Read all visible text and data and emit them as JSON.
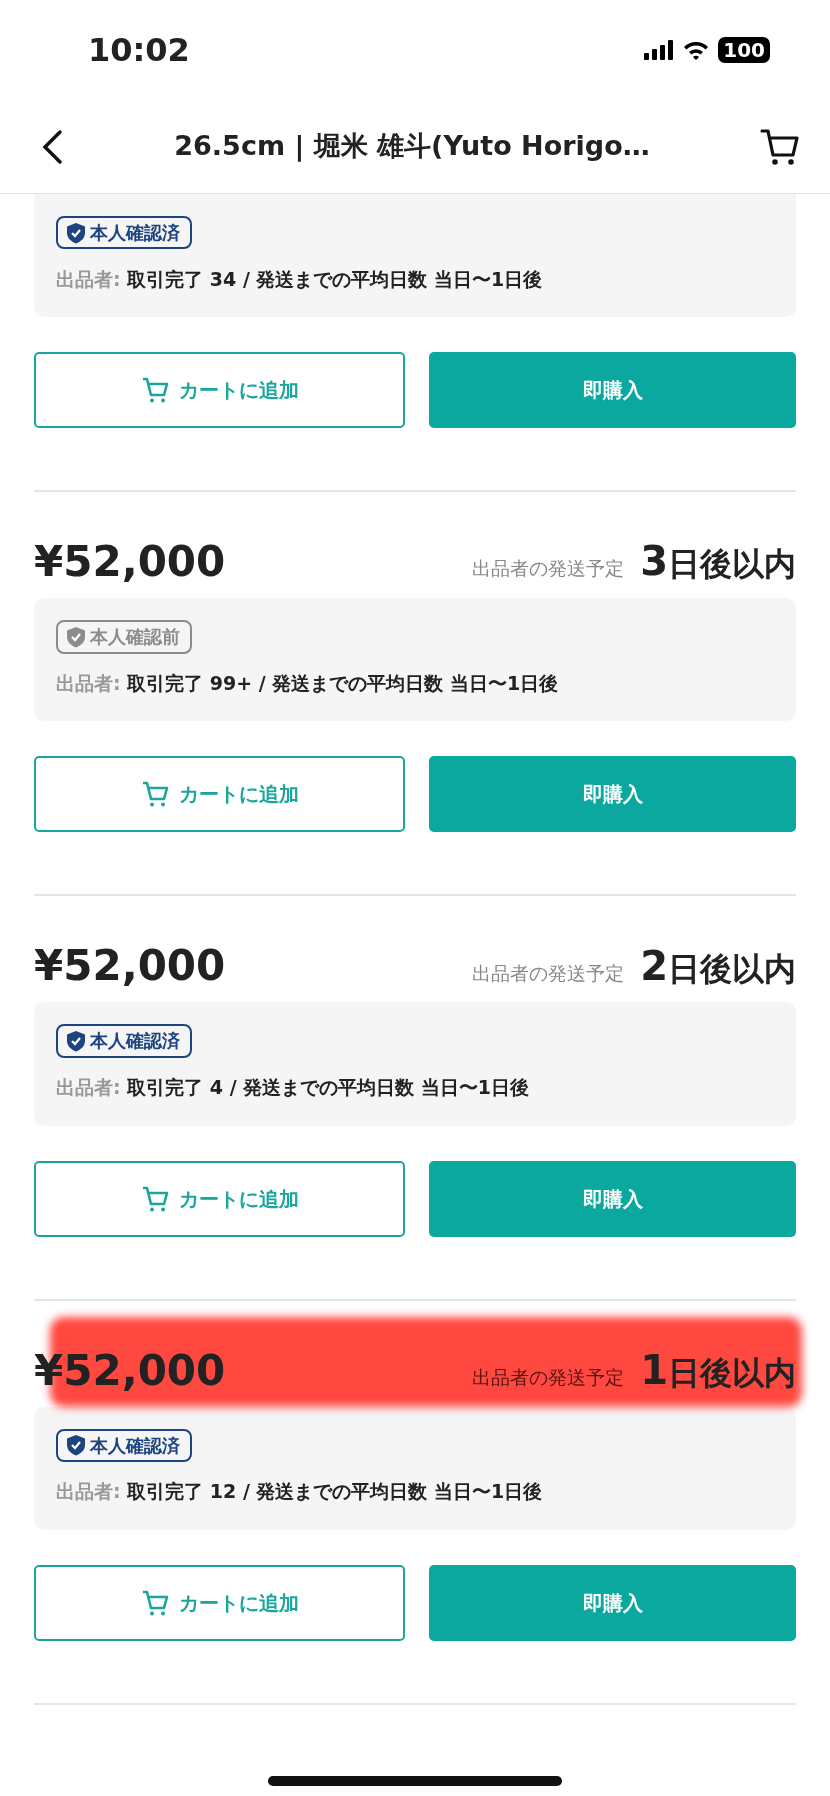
{
  "status_bar": {
    "time": "10:02",
    "battery": "100"
  },
  "header": {
    "title": "26.5cm | 堀米 雄斗(Yuto Horigo…"
  },
  "listings": [
    {
      "verified": true,
      "badge": "本人確認済",
      "seller_label": "出品者:",
      "seller_info": "取引完了 34 / 発送までの平均日数 当日〜1日後",
      "cart_button": "カートに追加",
      "buy_button": "即購入",
      "highlighted": false
    },
    {
      "price": "¥52,000",
      "ship_label": "出品者の発送予定",
      "ship_num": "3",
      "ship_unit": "日後以内",
      "verified": false,
      "badge": "本人確認前",
      "seller_label": "出品者:",
      "seller_info": "取引完了 99+ / 発送までの平均日数 当日〜1日後",
      "cart_button": "カートに追加",
      "buy_button": "即購入",
      "highlighted": false
    },
    {
      "price": "¥52,000",
      "ship_label": "出品者の発送予定",
      "ship_num": "2",
      "ship_unit": "日後以内",
      "verified": true,
      "badge": "本人確認済",
      "seller_label": "出品者:",
      "seller_info": "取引完了 4 / 発送までの平均日数 当日〜1日後",
      "cart_button": "カートに追加",
      "buy_button": "即購入",
      "highlighted": false
    },
    {
      "price": "¥52,000",
      "ship_label": "出品者の発送予定",
      "ship_num": "1",
      "ship_unit": "日後以内",
      "verified": true,
      "badge": "本人確認済",
      "seller_label": "出品者:",
      "seller_info": "取引完了 12 / 発送までの平均日数 当日〜1日後",
      "cart_button": "カートに追加",
      "buy_button": "即購入",
      "highlighted": true
    }
  ]
}
